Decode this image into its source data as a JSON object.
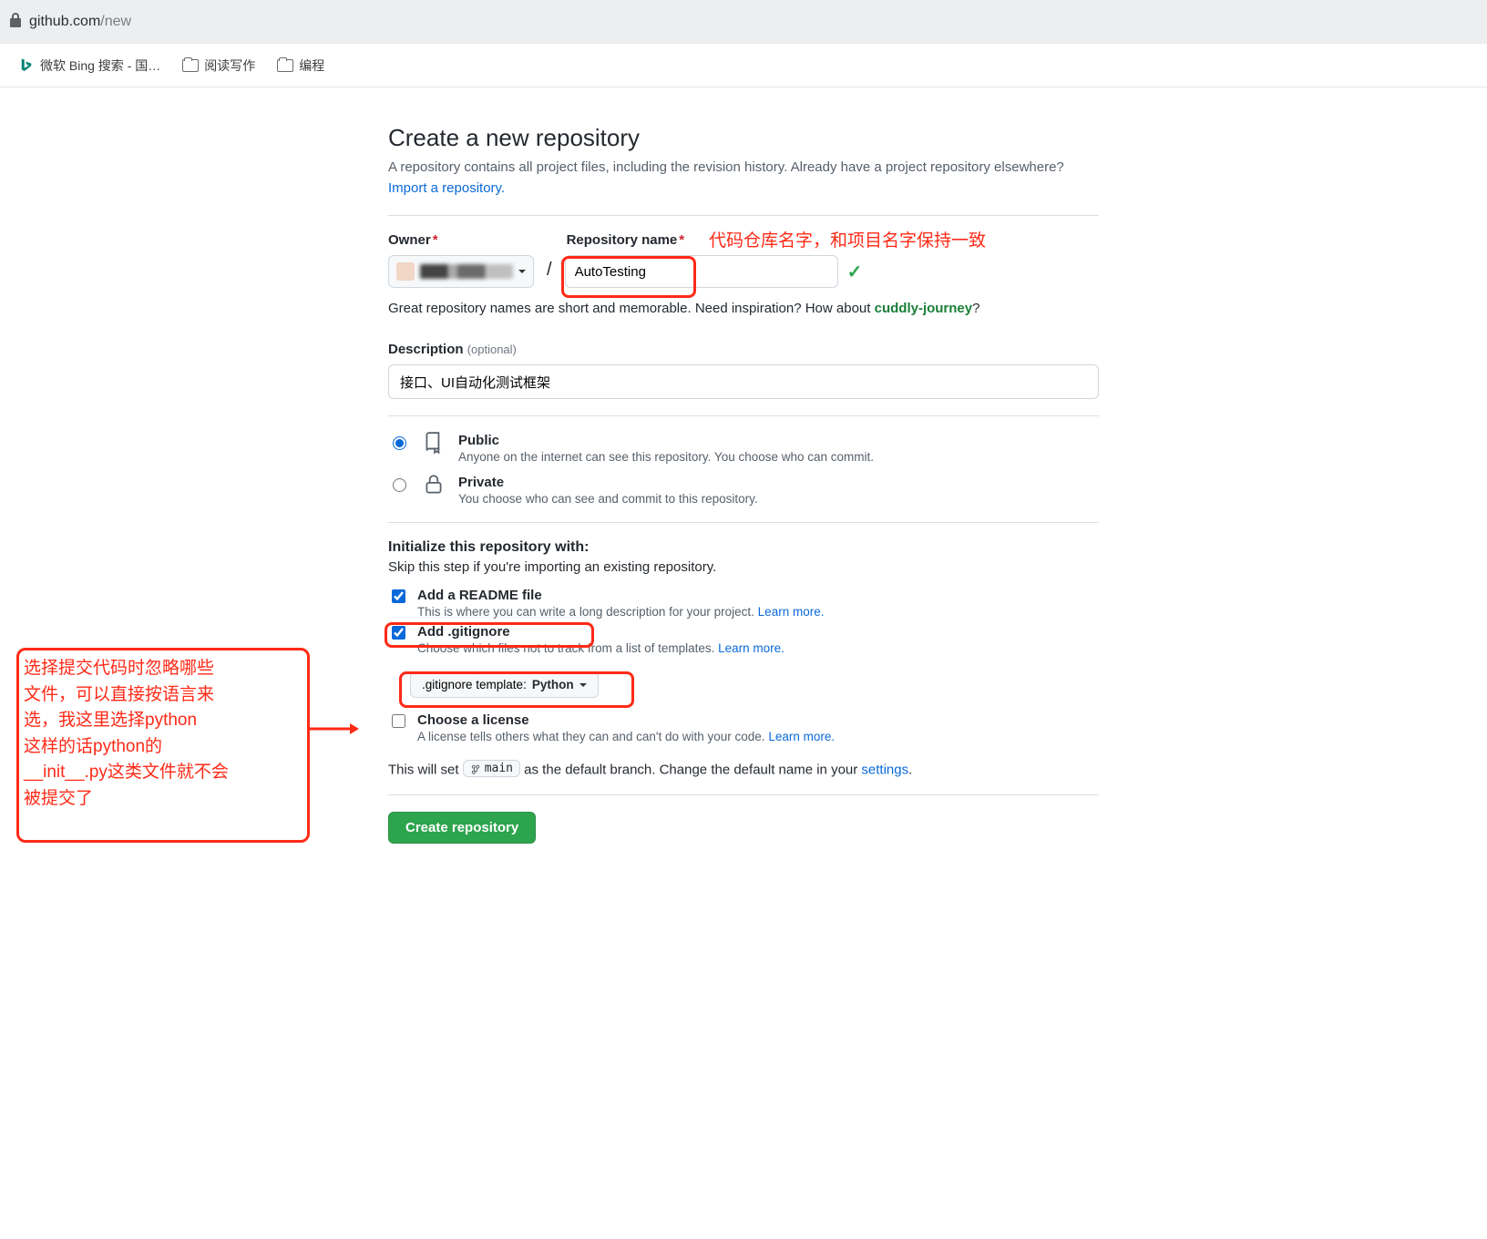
{
  "browser": {
    "url_domain": "github.com",
    "url_path": "/new"
  },
  "bookmarks": {
    "bing": "微软 Bing 搜索 - 国…",
    "read_write": "阅读写作",
    "programming": "编程"
  },
  "header": {
    "title": "Create a new repository",
    "subtitle_before": "A repository contains all project files, including the revision history. Already have a project repository elsewhere? ",
    "import_link": "Import a repository.",
    "subtitle_after": ""
  },
  "owner": {
    "label": "Owner"
  },
  "repo": {
    "label": "Repository name",
    "value": "AutoTesting"
  },
  "hint": {
    "before": "Great repository names are short and memorable. Need inspiration? How about ",
    "suggestion": "cuddly-journey",
    "after": "?"
  },
  "description": {
    "label": "Description",
    "optional": "(optional)",
    "value": "接口、UI自动化测试框架"
  },
  "visibility": {
    "public": {
      "title": "Public",
      "desc": "Anyone on the internet can see this repository. You choose who can commit."
    },
    "private": {
      "title": "Private",
      "desc": "You choose who can see and commit to this repository."
    }
  },
  "init": {
    "head": "Initialize this repository with:",
    "sub": "Skip this step if you're importing an existing repository.",
    "readme": {
      "title": "Add a README file",
      "desc": "This is where you can write a long description for your project. ",
      "learn": "Learn more."
    },
    "gitignore": {
      "title": "Add .gitignore",
      "desc": "Choose which files not to track from a list of templates. ",
      "learn": "Learn more."
    },
    "template_label_prefix": ".gitignore template: ",
    "template_value": "Python",
    "license": {
      "title": "Choose a license",
      "desc": "A license tells others what they can and can't do with your code. ",
      "learn": "Learn more."
    }
  },
  "branch": {
    "before": "This will set ",
    "name": "main",
    "after": " as the default branch. Change the default name in your ",
    "settings": "settings",
    "period": "."
  },
  "create_button": "Create repository",
  "annotations": {
    "repo_name": "代码仓库名字，和项目名字保持一致",
    "gitignore": "选择提交代码时忽略哪些\n文件，可以直接按语言来\n选，我这里选择python\n这样的话python的\n__init__.py这类文件就不会\n被提交了"
  }
}
